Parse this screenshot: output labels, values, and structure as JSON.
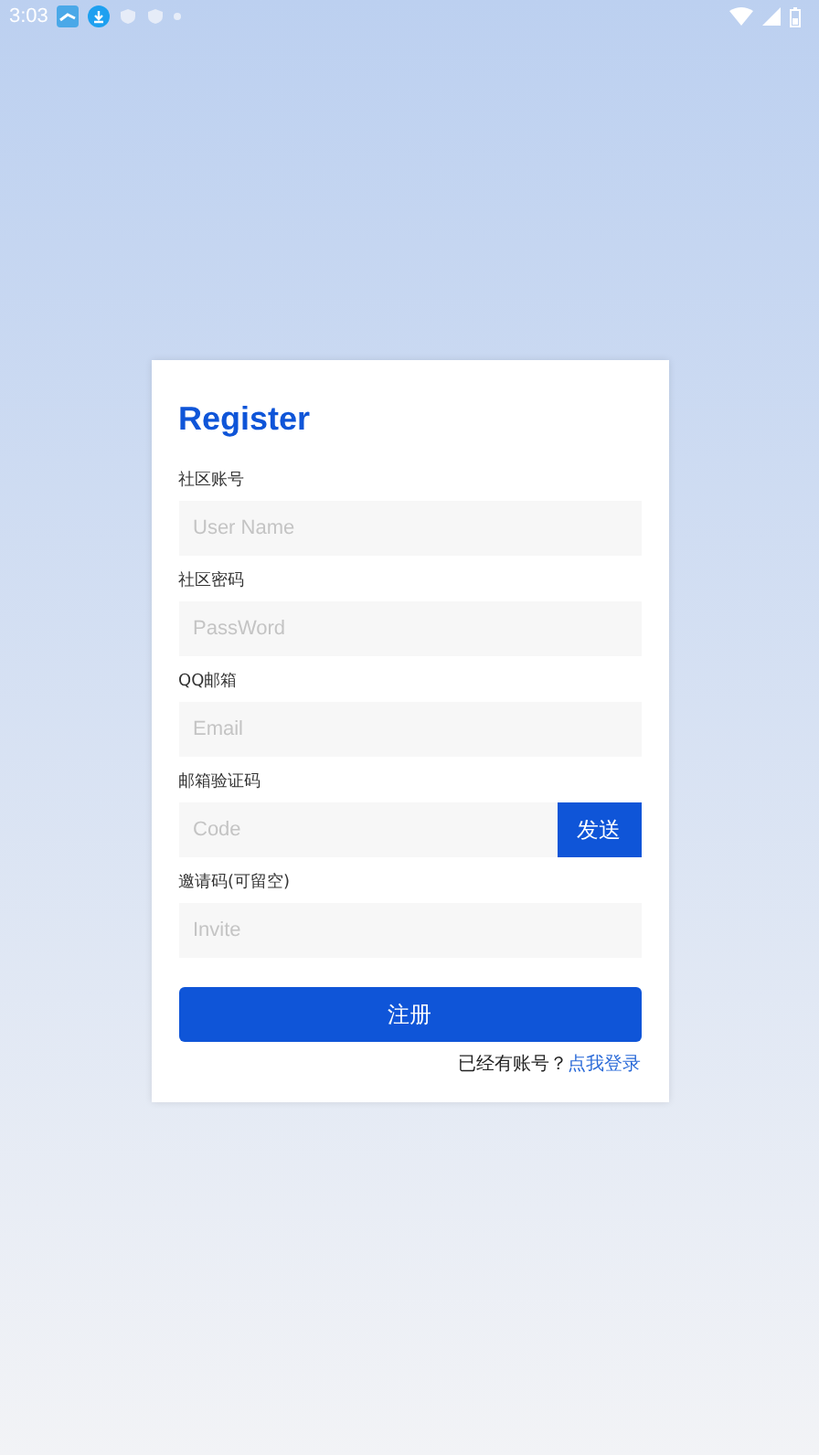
{
  "status_bar": {
    "time": "3:03"
  },
  "form": {
    "title": "Register",
    "fields": [
      {
        "kind": "text",
        "label": "社区账号",
        "placeholder": "User Name"
      },
      {
        "kind": "text",
        "label": "社区密码",
        "placeholder": "PassWord"
      },
      {
        "kind": "text",
        "label": "QQ邮箱",
        "placeholder": "Email"
      },
      {
        "kind": "with_button",
        "label": "邮箱验证码",
        "placeholder": "Code",
        "button": "发送"
      },
      {
        "kind": "text",
        "label": "邀请码(可留空)",
        "placeholder": "Invite"
      }
    ],
    "submit": "注册",
    "login_prompt": "已经有账号？",
    "login_link": "点我登录"
  }
}
